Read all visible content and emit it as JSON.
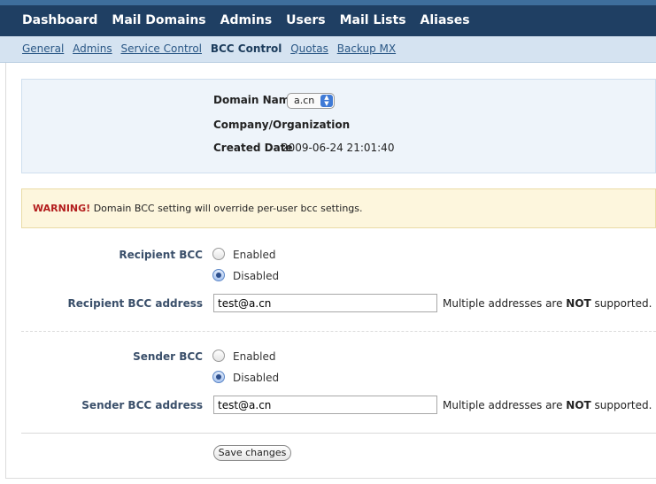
{
  "topnav": [
    "Dashboard",
    "Mail Domains",
    "Admins",
    "Users",
    "Mail Lists",
    "Aliases"
  ],
  "subnav": {
    "items": [
      "General",
      "Admins",
      "Service Control",
      "BCC Control",
      "Quotas",
      "Backup MX"
    ],
    "active": "BCC Control"
  },
  "domain": {
    "name_label": "Domain Name",
    "name_value": "a.cn",
    "company_label": "Company/Organization",
    "created_label": "Created Date",
    "created_value": "2009-06-24 21:01:40"
  },
  "warning": {
    "strong": "WARNING!",
    "text": "Domain BCC setting will override per-user bcc settings."
  },
  "recipient": {
    "label": "Recipient BCC",
    "enabled_label": "Enabled",
    "disabled_label": "Disabled",
    "selected": "Disabled",
    "address_label": "Recipient BCC address",
    "address_value": "test@a.cn",
    "note_pre": "Multiple addresses are ",
    "note_strong": "NOT",
    "note_post": " supported."
  },
  "sender": {
    "label": "Sender BCC",
    "enabled_label": "Enabled",
    "disabled_label": "Disabled",
    "selected": "Disabled",
    "address_label": "Sender BCC address",
    "address_value": "test@a.cn",
    "note_pre": "Multiple addresses are ",
    "note_strong": "NOT",
    "note_post": " supported."
  },
  "save_label": "Save changes",
  "colors": {
    "topbar": "#1f3f63",
    "subbar": "#d5e3f1",
    "warning_bg": "#fdf6dd",
    "warning_text": "#b31d1d"
  }
}
